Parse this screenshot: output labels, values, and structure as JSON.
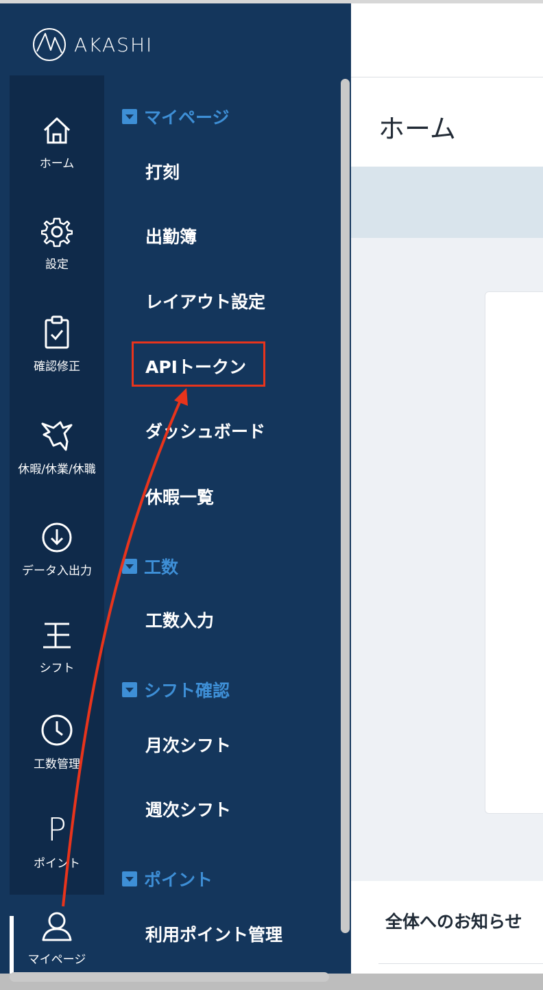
{
  "app": {
    "logo_text": "AKASHI"
  },
  "rail": [
    {
      "label": "ホーム",
      "icon": "home-icon"
    },
    {
      "label": "設定",
      "icon": "gear-icon"
    },
    {
      "label": "確認修正",
      "icon": "clipboard-check-icon"
    },
    {
      "label": "休暇/休業/休職",
      "icon": "bird-icon"
    },
    {
      "label": "データ入出力",
      "icon": "download-circle-icon"
    },
    {
      "label": "シフト",
      "icon": "shift-icon"
    },
    {
      "label": "工数管理",
      "icon": "clock-icon"
    },
    {
      "label": "ポイント",
      "icon": "point-icon",
      "glyph": "P"
    },
    {
      "label": "マイページ",
      "icon": "user-icon"
    }
  ],
  "menu": {
    "sections": [
      {
        "title": "マイページ",
        "items": [
          "打刻",
          "出勤簿",
          "レイアウト設定",
          "APIトークン",
          "ダッシュボード",
          "休暇一覧"
        ]
      },
      {
        "title": "工数",
        "items": [
          "工数入力"
        ]
      },
      {
        "title": "シフト確認",
        "items": [
          "月次シフト",
          "週次シフト"
        ]
      },
      {
        "title": "ポイント",
        "items": [
          "利用ポイント管理"
        ]
      }
    ]
  },
  "main": {
    "page_title": "ホーム",
    "notice_title": "全体へのお知らせ"
  },
  "colors": {
    "sidebar_bg": "#14365c",
    "rail_bg": "#0f2a4a",
    "section_accent": "#3e8fd6",
    "annotation_red": "#e8341c"
  }
}
